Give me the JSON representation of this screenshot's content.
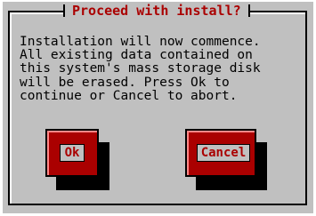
{
  "dialog": {
    "title": "Proceed with install?",
    "message": "Installation will now commence.\nAll existing data contained on\nthis system's mass storage disk\nwill be erased. Press Ok to\ncontinue or Cancel to abort."
  },
  "buttons": {
    "ok_label": "Ok",
    "cancel_label": "Cancel"
  },
  "colors": {
    "dialog_bg": "#c0c0c0",
    "accent": "#aa0000",
    "text": "#000000"
  }
}
